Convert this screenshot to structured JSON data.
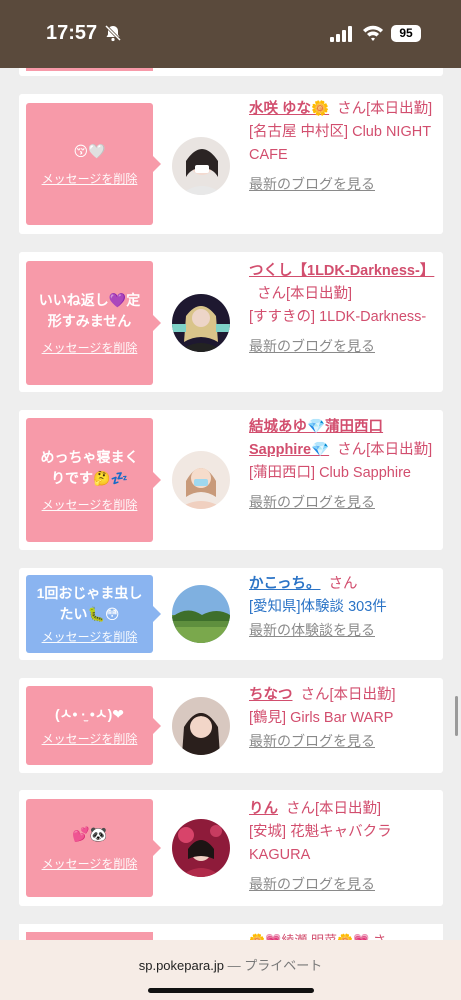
{
  "status": {
    "time": "17:57",
    "battery": "95"
  },
  "browser": {
    "domain": "sp.pokepara.jp",
    "mode": "— プライベート"
  },
  "cards": [
    {
      "bubble_color": "pink",
      "message": "😚🤍",
      "delete_label": "メッセージを削除",
      "name": "水咲 ゆな🌼",
      "san": "さん",
      "status": "[本日出勤]",
      "location": "[名古屋 中村区] Club NIGHT CAFE",
      "link": "最新のブログを見る"
    },
    {
      "bubble_color": "pink",
      "message": "いいね返し💜定形すみません",
      "delete_label": "メッセージを削除",
      "name": "つくし【1LDK-Darkness-】",
      "san": "さん",
      "status": "[本日出勤]",
      "location": "[すすきの] 1LDK-Darkness-",
      "link": "最新のブログを見る"
    },
    {
      "bubble_color": "pink",
      "message": "めっちゃ寝まくりです🤔💤",
      "delete_label": "メッセージを削除",
      "name": "結城あゆ💎蒲田西口Sapphire💎",
      "san": "さん",
      "status": "[本日出勤]",
      "location": "[蒲田西口] Club Sapphire",
      "link": "最新のブログを見る"
    },
    {
      "bubble_color": "blue",
      "message": "1回おじゃま虫したい🐛😳",
      "delete_label": "メッセージを削除",
      "name": "かこっち。",
      "san": "さん",
      "status": "",
      "location": "[愛知県]体験談 303件",
      "link": "最新の体験談を見る"
    },
    {
      "bubble_color": "pink",
      "message": "(ㅅ• ·̫ •ㅅ)❤",
      "delete_label": "メッセージを削除",
      "name": "ちなつ",
      "san": "さん",
      "status": "[本日出勤]",
      "location": "[鶴見] Girls Bar WARP",
      "link": "最新のブログを見る"
    },
    {
      "bubble_color": "pink",
      "message": "💕🐼",
      "delete_label": "メッセージを削除",
      "name": "りん",
      "san": "さん",
      "status": "[本日出勤]",
      "location": "[安城] 花魁キャバクラKAGURA",
      "link": "最新のブログを見る"
    }
  ],
  "partial_bottom_text": "🌼💗綾瀬 明菜🌼💗 さ"
}
